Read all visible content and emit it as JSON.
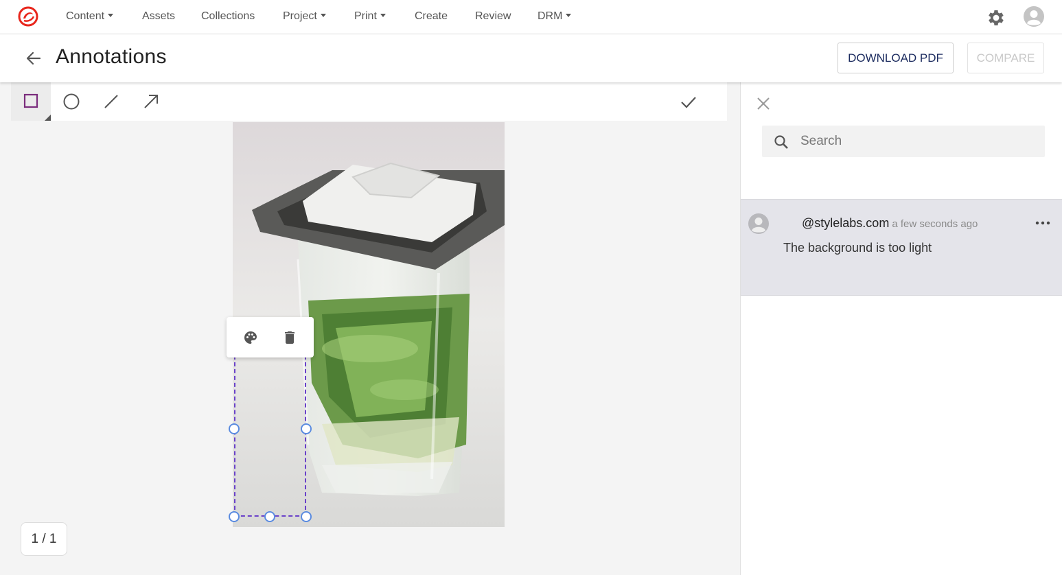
{
  "nav": {
    "items": [
      {
        "label": "Content",
        "has_menu": true
      },
      {
        "label": "Assets",
        "has_menu": false
      },
      {
        "label": "Collections",
        "has_menu": false
      },
      {
        "label": "Project",
        "has_menu": true
      },
      {
        "label": "Print",
        "has_menu": true
      },
      {
        "label": "Create",
        "has_menu": false
      },
      {
        "label": "Review",
        "has_menu": false
      },
      {
        "label": "DRM",
        "has_menu": true
      }
    ],
    "logo_color": "#e8261c"
  },
  "header": {
    "title": "Annotations",
    "download_label": "DOWNLOAD PDF",
    "compare_label": "COMPARE"
  },
  "toolbar": {
    "tools": [
      "rectangle-icon",
      "ellipse-icon",
      "line-icon",
      "arrow-icon"
    ],
    "active_tool": "rectangle",
    "annotation_color": "#7b2d7d"
  },
  "pager": {
    "label": "1 / 1"
  },
  "panel": {
    "search_placeholder": "Search",
    "comment": {
      "user": "@stylelabs.com",
      "time": "a few seconds ago",
      "text": "The background is too light"
    }
  }
}
